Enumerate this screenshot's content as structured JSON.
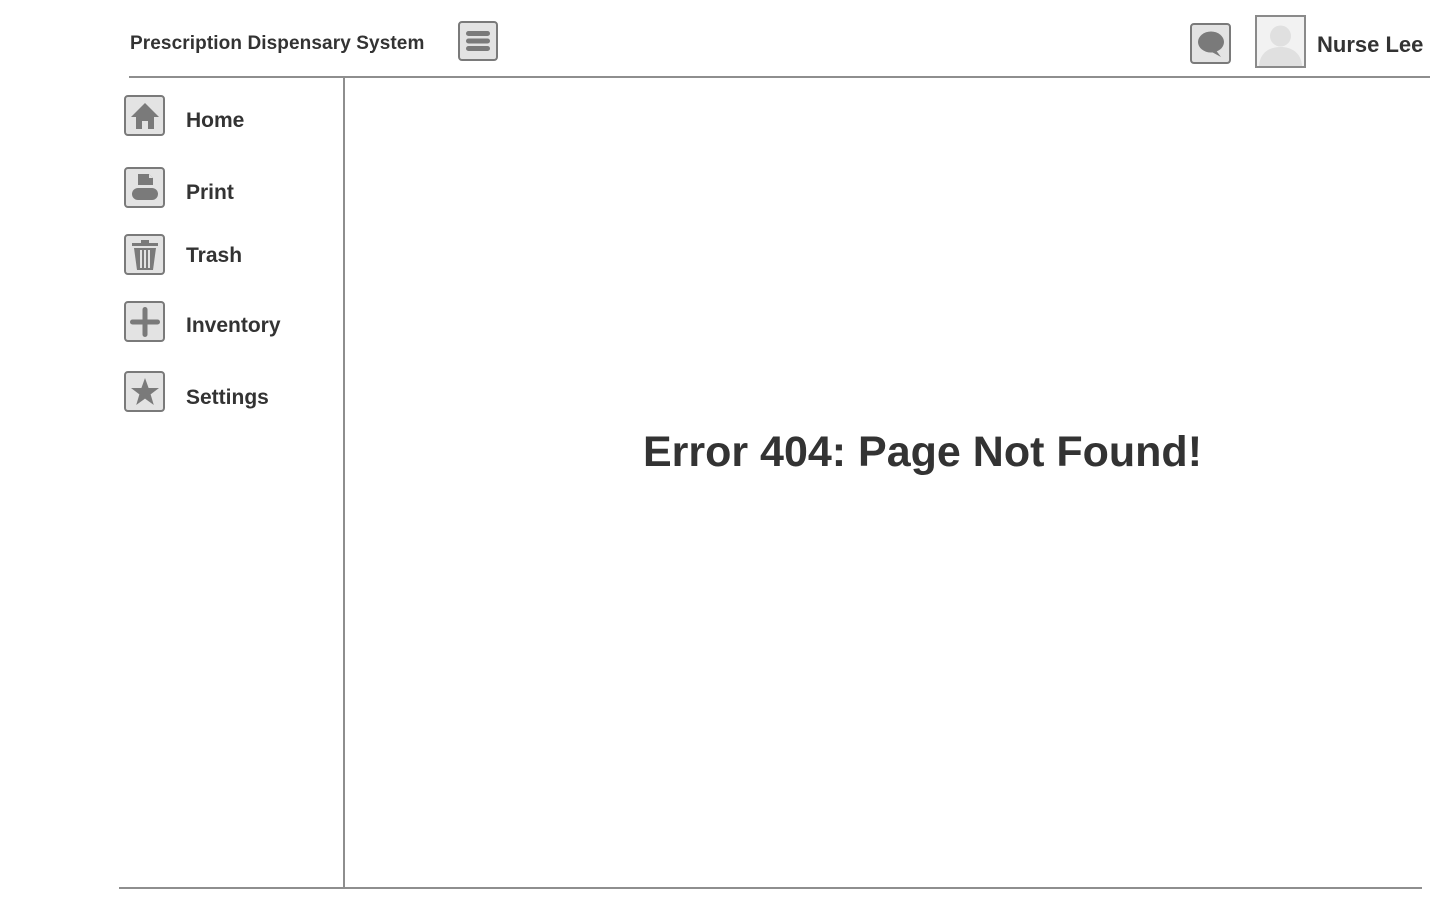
{
  "header": {
    "app_title": "Prescription Dispensary System",
    "menu_icon": "hamburger-menu-icon",
    "chat_icon": "speech-bubble-icon",
    "avatar_icon": "user-avatar-placeholder",
    "user_name": "Nurse Lee"
  },
  "sidebar": {
    "items": [
      {
        "label": "Home",
        "icon": "home-icon"
      },
      {
        "label": "Print",
        "icon": "printer-icon"
      },
      {
        "label": "Trash",
        "icon": "trash-icon"
      },
      {
        "label": "Inventory",
        "icon": "plus-icon"
      },
      {
        "label": "Settings",
        "icon": "star-icon"
      }
    ]
  },
  "main": {
    "error_message": "Error 404: Page Not Found!"
  },
  "colors": {
    "text": "#333333",
    "icon_fill": "#7a7a7a",
    "icon_background": "#e3e3e3",
    "rule": "#8e8e8e"
  }
}
